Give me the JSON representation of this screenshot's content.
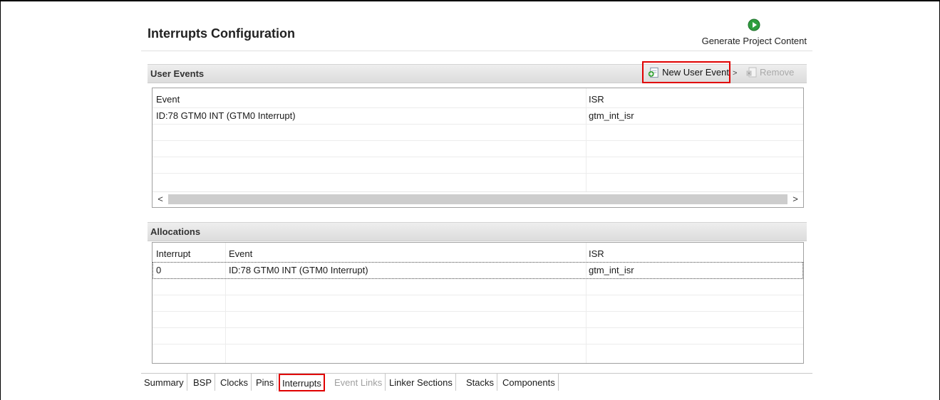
{
  "page": {
    "title": "Interrupts Configuration",
    "generate": {
      "label": "Generate Project Content",
      "icon": "play-circle-icon"
    }
  },
  "user_events": {
    "section_title": "User Events",
    "new_button": {
      "label": "New User Event",
      "icon": "add-document-icon"
    },
    "remove_button": {
      "label": "Remove",
      "icon": "remove-document-icon"
    },
    "columns": [
      "Event",
      "ISR"
    ],
    "rows": [
      {
        "event": "ID:78 GTM0 INT (GTM0 Interrupt)",
        "isr": "gtm_int_isr"
      }
    ],
    "scroll_left": "<",
    "scroll_right": ">"
  },
  "allocations": {
    "section_title": "Allocations",
    "columns": [
      "Interrupt",
      "Event",
      "ISR"
    ],
    "rows": [
      {
        "interrupt": "0",
        "event": "ID:78 GTM0 INT (GTM0 Interrupt)",
        "isr": "gtm_int_isr"
      }
    ]
  },
  "tabs": [
    {
      "label": "Summary",
      "state": "normal"
    },
    {
      "label": "BSP",
      "state": "normal"
    },
    {
      "label": "Clocks",
      "state": "normal"
    },
    {
      "label": "Pins",
      "state": "normal"
    },
    {
      "label": "Interrupts",
      "state": "active"
    },
    {
      "label": "Event Links",
      "state": "disabled"
    },
    {
      "label": "Linker Sections",
      "state": "normal"
    },
    {
      "label": "Stacks",
      "state": "normal"
    },
    {
      "label": "Components",
      "state": "normal"
    }
  ],
  "colors": {
    "highlight": "#e00000",
    "generate_icon": "#2e9e3e",
    "disabled_text": "#a0a0a0"
  }
}
